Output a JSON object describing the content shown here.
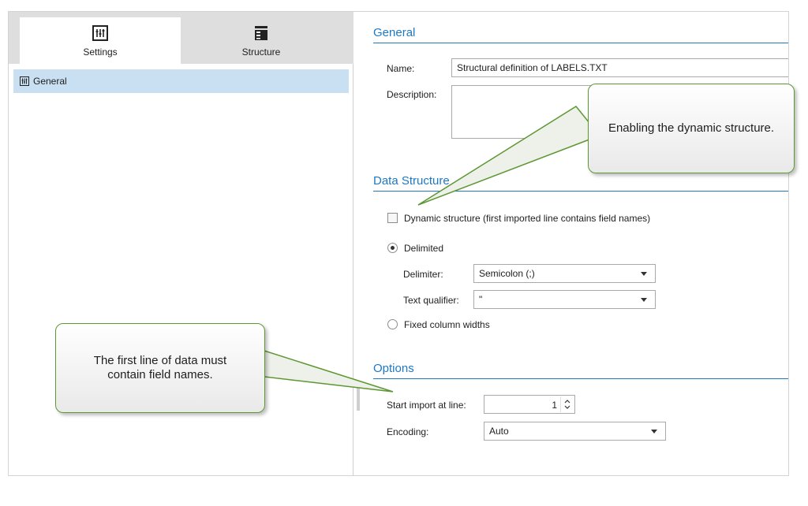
{
  "tabs": [
    {
      "label": "Settings",
      "icon": "settings-sliders-icon",
      "active": true
    },
    {
      "label": "Structure",
      "icon": "structure-table-icon",
      "active": false
    }
  ],
  "sidebar": {
    "items": [
      {
        "label": "General",
        "icon": "settings-sliders-icon",
        "selected": true
      }
    ]
  },
  "general": {
    "title": "General",
    "name_label": "Name:",
    "name_value": "Structural definition of LABELS.TXT",
    "description_label": "Description:",
    "description_value": ""
  },
  "data_structure": {
    "title": "Data Structure",
    "dynamic_label": "Dynamic structure (first imported line contains field names)",
    "dynamic_checked": false,
    "delimited_label": "Delimited",
    "delimited_checked": true,
    "delimiter_label": "Delimiter:",
    "delimiter_value": "Semicolon (;)",
    "qualifier_label": "Text qualifier:",
    "qualifier_value": "\"",
    "fixed_label": "Fixed column widths",
    "fixed_checked": false
  },
  "options": {
    "title": "Options",
    "start_label": "Start import at line:",
    "start_value": "1",
    "encoding_label": "Encoding:",
    "encoding_value": "Auto"
  },
  "callouts": {
    "dynamic": "Enabling the dynamic structure.",
    "first_line": "The first line of data must contain field names."
  },
  "colors": {
    "accent": "#1f78c1",
    "selection": "#c9e0f3",
    "callout_border": "#5d9732"
  }
}
